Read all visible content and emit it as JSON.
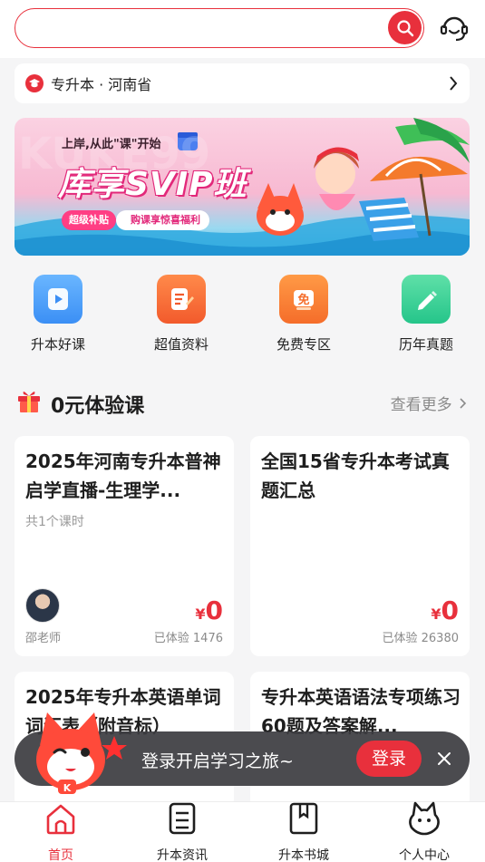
{
  "search": {
    "placeholder": ""
  },
  "region": {
    "label": "专升本 · 河南省"
  },
  "banner": {
    "tagline": "上岸,从此\"课\"开始",
    "headline": "库享SVIP班",
    "pill_left": "超级补贴",
    "pill_right": "购课享惊喜福利"
  },
  "quick_nav": [
    {
      "label": "升本好课",
      "icon": "play-card-icon",
      "color": "#3b8ff5"
    },
    {
      "label": "超值资料",
      "icon": "document-edit-icon",
      "color": "#f25a2c"
    },
    {
      "label": "免费专区",
      "icon": "free-box-icon",
      "color": "#f56d2a"
    },
    {
      "label": "历年真题",
      "icon": "pencil-icon",
      "color": "#25c58a"
    }
  ],
  "section": {
    "title": "0元体验课",
    "more": "查看更多"
  },
  "courses": [
    {
      "title": "2025年河南专升本普神启学直播-生理学...",
      "subtitle": "共1个课时",
      "teacher": "邵老师",
      "currency": "¥",
      "price": "0",
      "tried": "已体验 1476"
    },
    {
      "title": "全国15省专升本考试真题汇总",
      "subtitle": "",
      "teacher": "",
      "currency": "¥",
      "price": "0",
      "tried": "已体验 26380"
    },
    {
      "title": "2025年专升本英语单词词汇表（附音标）",
      "subtitle": "",
      "teacher": "",
      "currency": "",
      "price": "",
      "tried": ""
    },
    {
      "title": "专升本英语语法专项练习60题及答案解...",
      "subtitle": "",
      "teacher": "",
      "currency": "",
      "price": "",
      "tried": ""
    }
  ],
  "login_prompt": {
    "text": "登录开启学习之旅~",
    "button": "登录"
  },
  "tabs": [
    {
      "label": "首页",
      "icon": "home-icon",
      "active": true
    },
    {
      "label": "升本资讯",
      "icon": "news-icon",
      "active": false
    },
    {
      "label": "升本书城",
      "icon": "book-icon",
      "active": false
    },
    {
      "label": "个人中心",
      "icon": "profile-icon",
      "active": false
    }
  ],
  "colors": {
    "accent": "#e8303c",
    "muted": "#8a8a8a",
    "background": "#f5f5f6"
  }
}
